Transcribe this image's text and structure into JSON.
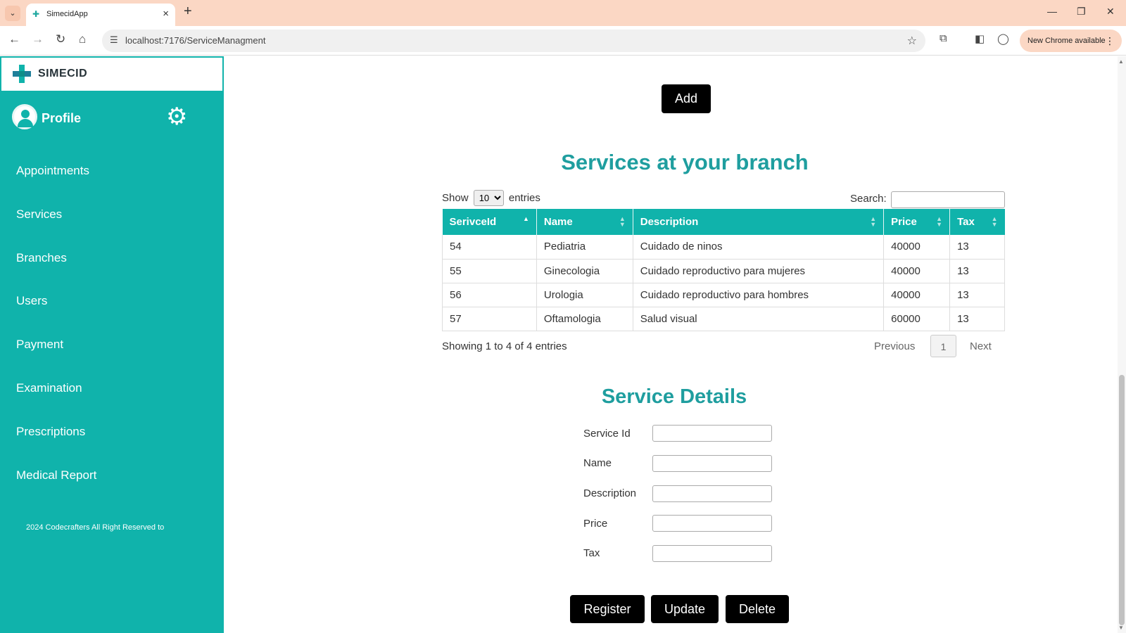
{
  "browser": {
    "tab_title": "SimecidApp",
    "url": "localhost:7176/ServiceManagment",
    "update_label": "New Chrome available"
  },
  "sidebar": {
    "brand": "SIMECID",
    "profile_label": "Profile",
    "items": [
      {
        "label": "Appointments"
      },
      {
        "label": "Services"
      },
      {
        "label": "Branches"
      },
      {
        "label": "Users"
      },
      {
        "label": "Payment"
      },
      {
        "label": "Examination"
      },
      {
        "label": "Prescriptions"
      },
      {
        "label": "Medical Report"
      }
    ],
    "footer": "2024 Codecrafters All Right Reserved to"
  },
  "main": {
    "add_label": "Add",
    "title": "Services at your branch",
    "show_label": "Show",
    "entries_label": "entries",
    "page_size": "10",
    "search_label": "Search:",
    "columns": [
      "SerivceId",
      "Name",
      "Description",
      "Price",
      "Tax"
    ],
    "rows": [
      [
        "54",
        "Pediatria",
        "Cuidado de ninos",
        "40000",
        "13"
      ],
      [
        "55",
        "Ginecologia",
        "Cuidado reproductivo para mujeres",
        "40000",
        "13"
      ],
      [
        "56",
        "Urologia",
        "Cuidado reproductivo para hombres",
        "40000",
        "13"
      ],
      [
        "57",
        "Oftamologia",
        "Salud visual",
        "60000",
        "13"
      ]
    ],
    "info": "Showing 1 to 4 of 4 entries",
    "prev_label": "Previous",
    "current_page": "1",
    "next_label": "Next"
  },
  "details": {
    "title": "Service Details",
    "fields": [
      {
        "label": "Service Id",
        "value": ""
      },
      {
        "label": "Name",
        "value": ""
      },
      {
        "label": "Description",
        "value": ""
      },
      {
        "label": "Price",
        "value": ""
      },
      {
        "label": "Tax",
        "value": ""
      }
    ],
    "register_label": "Register",
    "update_label": "Update",
    "delete_label": "Delete"
  },
  "colors": {
    "teal": "#10b3ab",
    "heading": "#1f9e9f",
    "chrome_accent": "#fbd7c4"
  }
}
